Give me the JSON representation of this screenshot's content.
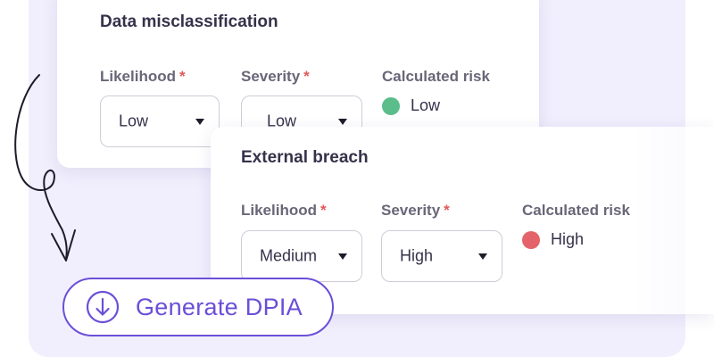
{
  "accent_color": "#6b4fd8",
  "risk_colors": {
    "low": "#5bbd8a",
    "high": "#e4636a"
  },
  "required_mark": "*",
  "cards": [
    {
      "title": "Data misclassification",
      "likelihood_label": "Likelihood",
      "likelihood_value": "Low",
      "severity_label": "Severity",
      "severity_value": "Low",
      "risk_label": "Calculated risk",
      "risk_value": "Low",
      "risk_color": "#5bbd8a"
    },
    {
      "title": "External breach",
      "likelihood_label": "Likelihood",
      "likelihood_value": "Medium",
      "severity_label": "Severity",
      "severity_value": "High",
      "risk_label": "Calculated risk",
      "risk_value": "High",
      "risk_color": "#e4636a"
    }
  ],
  "generate_button": {
    "label": "Generate DPIA",
    "icon": "download-arrow-icon"
  }
}
